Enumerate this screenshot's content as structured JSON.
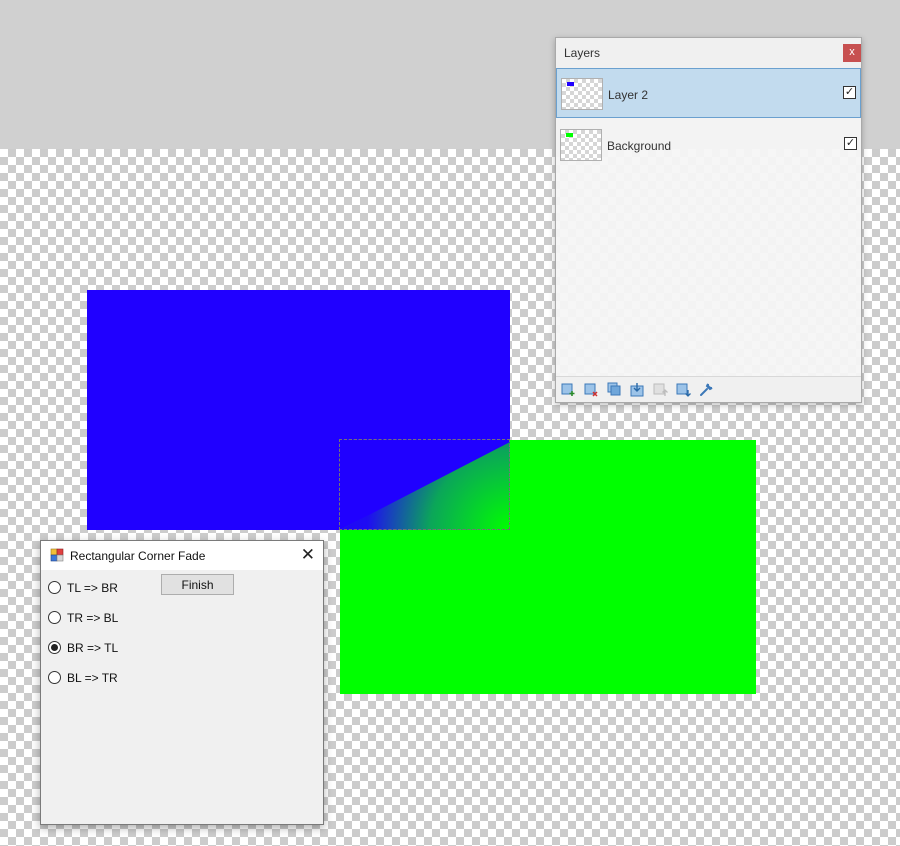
{
  "canvas": {
    "blue_color": "#2000ff",
    "green_color": "#00ff00"
  },
  "layers_panel": {
    "title": "Layers",
    "close_label": "x",
    "layers": [
      {
        "name": "Layer 2",
        "selected": true,
        "visible": true,
        "thumb_color": "#2000ff"
      },
      {
        "name": "Background",
        "selected": false,
        "visible": true,
        "thumb_color": "#00ff00"
      }
    ],
    "toolbar": [
      {
        "icon": "add-layer-icon",
        "enabled": true
      },
      {
        "icon": "delete-layer-icon",
        "enabled": true
      },
      {
        "icon": "duplicate-layer-icon",
        "enabled": true
      },
      {
        "icon": "merge-layer-down-icon",
        "enabled": true
      },
      {
        "icon": "move-layer-up-icon",
        "enabled": false
      },
      {
        "icon": "move-layer-down-icon",
        "enabled": true
      },
      {
        "icon": "layer-properties-icon",
        "enabled": true
      }
    ],
    "checkmark": "✓"
  },
  "dialog": {
    "title": "Rectangular Corner Fade",
    "close_label": "✕",
    "finish_label": "Finish",
    "options": [
      {
        "label": "TL => BR",
        "checked": false
      },
      {
        "label": "TR => BL",
        "checked": false
      },
      {
        "label": "BR => TL",
        "checked": true
      },
      {
        "label": "BL => TR",
        "checked": false
      }
    ]
  }
}
